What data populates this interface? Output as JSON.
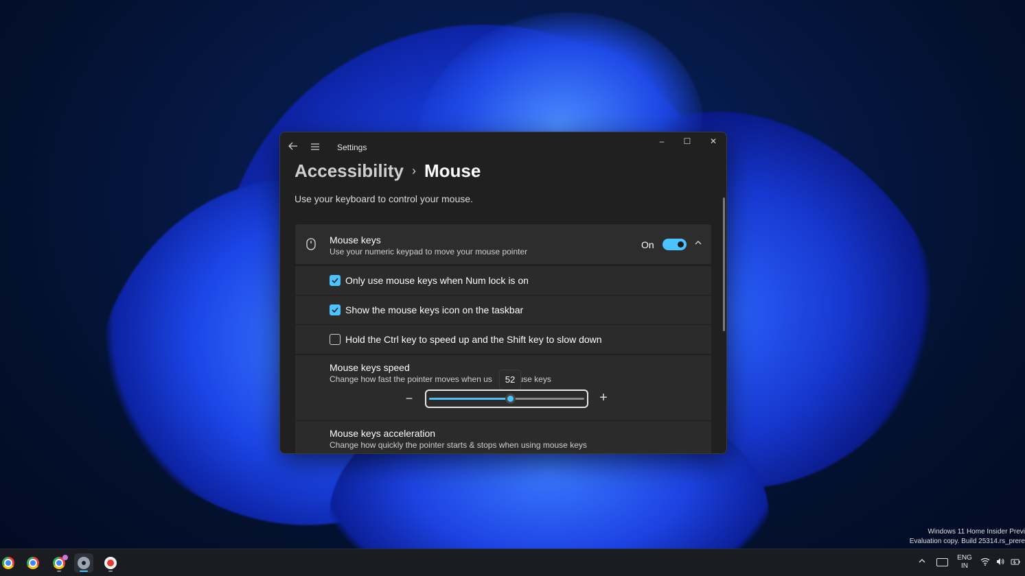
{
  "window": {
    "title": "Settings",
    "controls": {
      "minimize": "–",
      "maximize": "☐",
      "close": "✕"
    }
  },
  "breadcrumb": {
    "parent": "Accessibility",
    "separator": "›",
    "current": "Mouse"
  },
  "description": "Use your keyboard to control your mouse.",
  "mouse_keys": {
    "title": "Mouse keys",
    "subtitle": "Use your numeric keypad to move your mouse pointer",
    "state_label": "On",
    "enabled": true,
    "options": [
      {
        "label": "Only use mouse keys when Num lock is on",
        "checked": true
      },
      {
        "label": "Show the mouse keys icon on the taskbar",
        "checked": true
      },
      {
        "label": "Hold the Ctrl key to speed up and the Shift key to slow down",
        "checked": false
      }
    ]
  },
  "speed": {
    "title": "Mouse keys speed",
    "subtitle_left": "Change how fast the pointer moves when us",
    "subtitle_right": "ouse keys",
    "value": 52,
    "value_label": "52",
    "min_glyph": "−",
    "plus_glyph": "+"
  },
  "acceleration": {
    "title": "Mouse keys acceleration",
    "subtitle": "Change how quickly the pointer starts & stops when using mouse keys"
  },
  "watermark": {
    "line1": "Windows 11 Home Insider Previ",
    "line2": "Evaluation copy. Build 25314.rs_prere"
  },
  "taskbar": {
    "apps": [
      {
        "name": "chrome",
        "icon": "chrome-icon"
      },
      {
        "name": "chrome",
        "icon": "chrome-icon"
      },
      {
        "name": "chrome-profile",
        "icon": "chrome-icon"
      },
      {
        "name": "settings",
        "icon": "gear-icon"
      },
      {
        "name": "recorder",
        "icon": "recorder-icon"
      }
    ],
    "tray": {
      "lang_line1": "ENG",
      "lang_line2": "IN"
    }
  },
  "colors": {
    "accent": "#4cc2ff",
    "window_bg": "#202020",
    "card_bg": "#2b2b2b"
  }
}
